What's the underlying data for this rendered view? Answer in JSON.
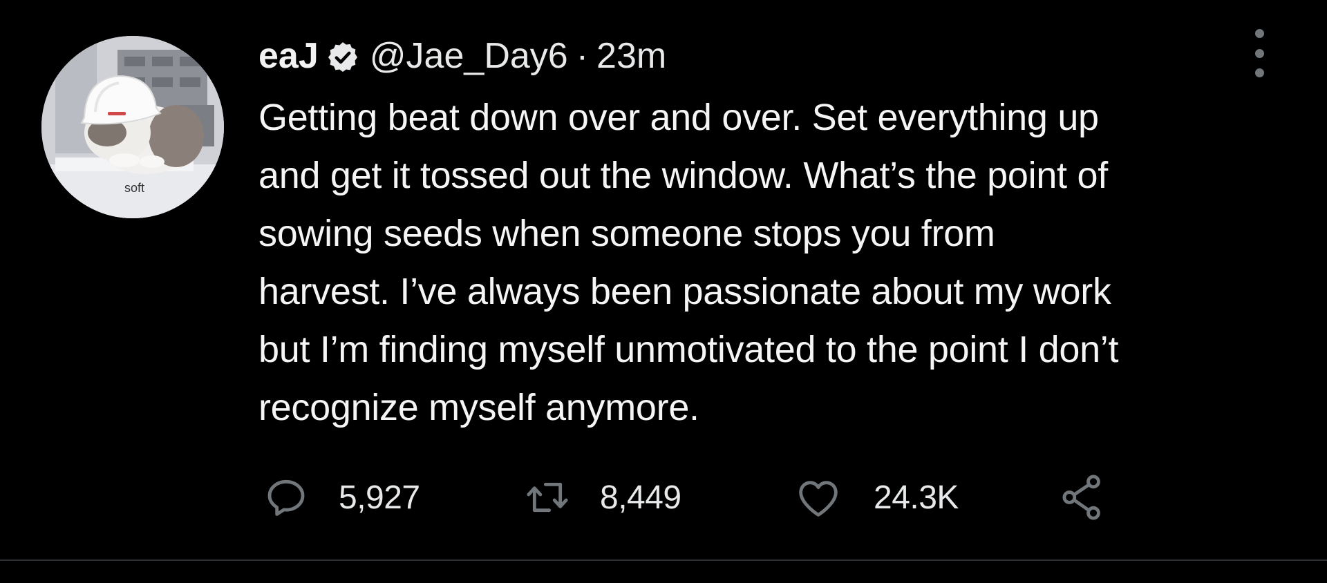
{
  "tweet": {
    "author": {
      "display_name": "eaJ",
      "verified": true,
      "handle": "@Jae_Day6",
      "separator": "·",
      "time": "23m",
      "avatar_caption": "soft"
    },
    "text": "Getting beat down over and over. Set everything up\nand get it tossed out the window. What’s the point of\nsowing seeds when someone stops you from\nharvest. I’ve always been passionate about my work\nbut I’m finding myself unmotivated to the point I don’t\nrecognize myself anymore.",
    "actions": {
      "reply_count": "5,927",
      "retweet_count": "8,449",
      "like_count": "24.3K"
    }
  },
  "icons": {
    "verified": "verified-badge-icon",
    "more": "more-vertical-icon",
    "reply": "reply-icon",
    "retweet": "retweet-icon",
    "like": "heart-icon",
    "share": "share-icon"
  },
  "colors": {
    "background": "#000000",
    "text": "#e7e9ea",
    "icon": "#71767b",
    "divider": "#2f3336"
  }
}
